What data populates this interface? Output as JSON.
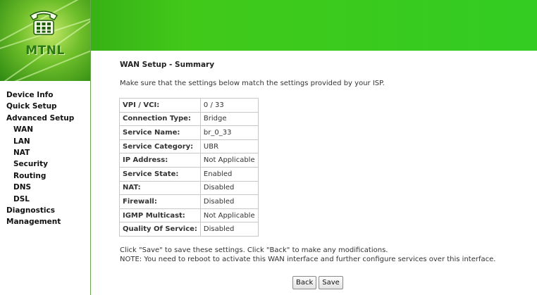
{
  "logo": {
    "text": "MTNL"
  },
  "nav": {
    "items": [
      {
        "label": "Device Info",
        "sub": false
      },
      {
        "label": "Quick Setup",
        "sub": false
      },
      {
        "label": "Advanced Setup",
        "sub": false
      },
      {
        "label": "WAN",
        "sub": true
      },
      {
        "label": "LAN",
        "sub": true
      },
      {
        "label": "NAT",
        "sub": true
      },
      {
        "label": "Security",
        "sub": true
      },
      {
        "label": "Routing",
        "sub": true
      },
      {
        "label": "DNS",
        "sub": true
      },
      {
        "label": "DSL",
        "sub": true
      },
      {
        "label": "Diagnostics",
        "sub": false
      },
      {
        "label": "Management",
        "sub": false
      }
    ]
  },
  "main": {
    "title": "WAN Setup - Summary",
    "intro": "Make sure that the settings below match the settings provided by your ISP.",
    "rows": [
      {
        "label": "VPI / VCI:",
        "value": "0 / 33"
      },
      {
        "label": "Connection Type:",
        "value": "Bridge"
      },
      {
        "label": "Service Name:",
        "value": "br_0_33"
      },
      {
        "label": "Service Category:",
        "value": "UBR"
      },
      {
        "label": "IP Address:",
        "value": "Not Applicable"
      },
      {
        "label": "Service State:",
        "value": "Enabled"
      },
      {
        "label": "NAT:",
        "value": "Disabled"
      },
      {
        "label": "Firewall:",
        "value": "Disabled"
      },
      {
        "label": "IGMP Multicast:",
        "value": "Not Applicable"
      },
      {
        "label": "Quality Of Service:",
        "value": "Disabled"
      }
    ],
    "note_line1": "Click \"Save\" to save these settings. Click \"Back\" to make any modifications.",
    "note_line2": "NOTE: You need to reboot to activate this WAN interface and further configure services over this interface.",
    "back_label": "Back",
    "save_label": "Save"
  },
  "colors": {
    "banner": "#33cc22",
    "logo_text": "#2a7a10"
  }
}
